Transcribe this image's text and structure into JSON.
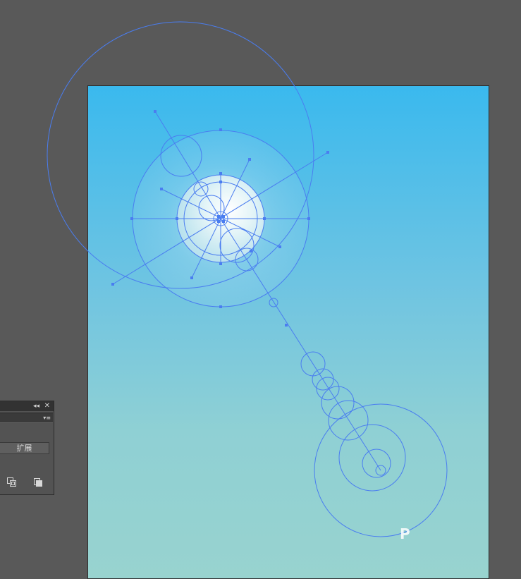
{
  "canvas": {
    "background_color": "#595959",
    "artboard_gradient": [
      "#3ab9ee",
      "#98d3cf"
    ],
    "selection_color": "#4a7df0"
  },
  "panel": {
    "collapse_icon": "double-chevron-left-icon",
    "collapse_glyph": "◂◂",
    "close_icon": "close-icon",
    "close_glyph": "✕",
    "dropdown_value": "",
    "menu_icon": "panel-menu-icon",
    "menu_glyph": "▾≡",
    "expand_label": "扩展",
    "tool_icons": [
      "expand-appearance-icon",
      "duplicate-icon"
    ]
  },
  "watermark": {
    "text": "P"
  }
}
